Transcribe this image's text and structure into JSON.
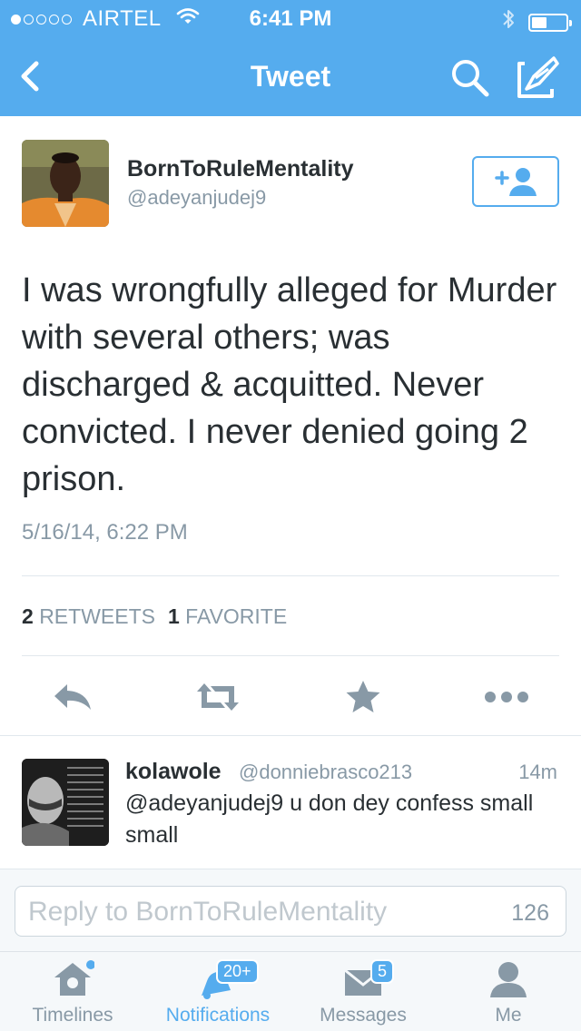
{
  "status_bar": {
    "carrier": "AIRTEL",
    "time": "6:41 PM",
    "signal_bars_filled": 1,
    "signal_bars_total": 5,
    "battery_level": 0.4
  },
  "nav": {
    "title": "Tweet",
    "back_icon": "chevron-left-icon",
    "search_icon": "search-icon",
    "compose_icon": "compose-icon"
  },
  "tweet": {
    "author_name": "BornToRuleMentality",
    "author_handle": "@adeyanjudej9",
    "text": "I was wrongfully alleged for Murder with several others; was discharged & acquitted. Never convicted. I never denied going 2 prison.",
    "timestamp": "5/16/14, 6:22 PM",
    "retweet_count": "2",
    "retweet_label": "RETWEETS",
    "favorite_count": "1",
    "favorite_label": "FAVORITE"
  },
  "reply": {
    "name": "kolawole",
    "handle": "@donniebrasco213",
    "time": "14m",
    "text": "@adeyanjudej9 u don dey confess small small"
  },
  "composer": {
    "placeholder": "Reply to BornToRuleMentality",
    "char_count": "126"
  },
  "tabs": [
    {
      "label": "Timelines",
      "icon": "home-icon",
      "active": false,
      "dot": true
    },
    {
      "label": "Notifications",
      "icon": "bell-icon",
      "active": true,
      "badge": "20+"
    },
    {
      "label": "Messages",
      "icon": "envelope-icon",
      "active": false,
      "badge": "5"
    },
    {
      "label": "Me",
      "icon": "person-icon",
      "active": false
    }
  ],
  "colors": {
    "brand_blue": "#55acee",
    "text_dark": "#292f33",
    "text_gray": "#8899a6",
    "background_light": "#f5f8fa"
  }
}
